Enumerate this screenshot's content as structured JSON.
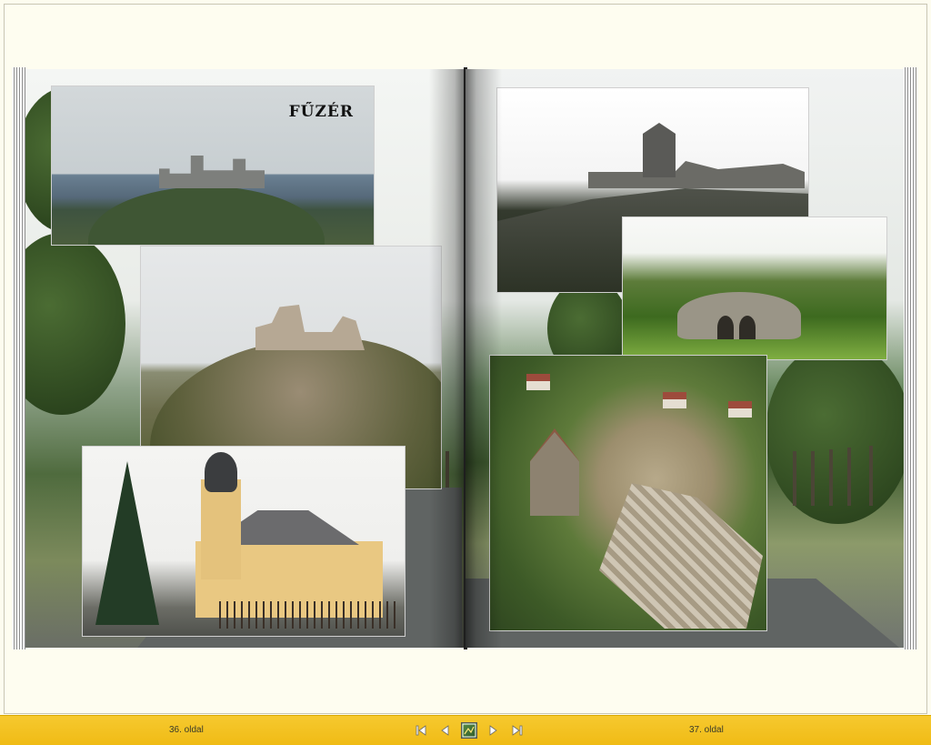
{
  "book": {
    "left_page": {
      "title_text": "FŰZÉR"
    },
    "right_page": {}
  },
  "navigation": {
    "left_page_label": "36. oldal",
    "right_page_label": "37. oldal",
    "controls": [
      {
        "name": "first-page",
        "icon": "first-page-icon"
      },
      {
        "name": "previous-page",
        "icon": "previous-page-icon"
      },
      {
        "name": "page-thumbnail",
        "icon": "thumbnail-icon"
      },
      {
        "name": "next-page",
        "icon": "next-page-icon"
      },
      {
        "name": "last-page",
        "icon": "last-page-icon"
      }
    ]
  },
  "colors": {
    "toolbar": "#f3c21f",
    "background": "#fdfcef"
  }
}
